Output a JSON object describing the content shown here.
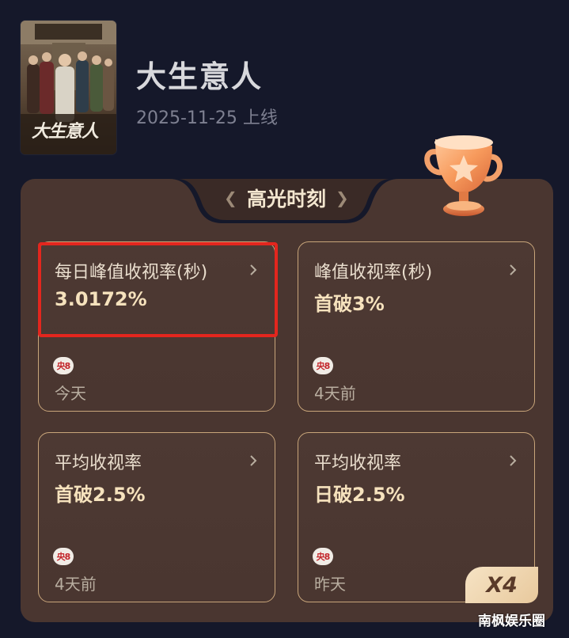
{
  "show": {
    "title": "大生意人",
    "release": "2025-11-25 上线",
    "poster_caption": "大生意人"
  },
  "highlights": {
    "title": "高光时刻",
    "multiplier": "X4",
    "cards": [
      {
        "label": "每日峰值收视率(秒)",
        "value": "3.0172%",
        "channel": "央8",
        "time": "今天"
      },
      {
        "label": "峰值收视率(秒)",
        "value": "首破3%",
        "channel": "央8",
        "time": "4天前"
      },
      {
        "label": "平均收视率",
        "value": "首破2.5%",
        "channel": "央8",
        "time": "4天前"
      },
      {
        "label": "平均收视率",
        "value": "日破2.5%",
        "channel": "央8",
        "time": "昨天"
      }
    ]
  },
  "watermark": "南枫娱乐圈",
  "colors": {
    "background": "#15182a",
    "panel": "#4a3630",
    "card_border": "#c8a57a",
    "highlight_border": "#e3261e",
    "value_text": "#f6e2bd"
  }
}
